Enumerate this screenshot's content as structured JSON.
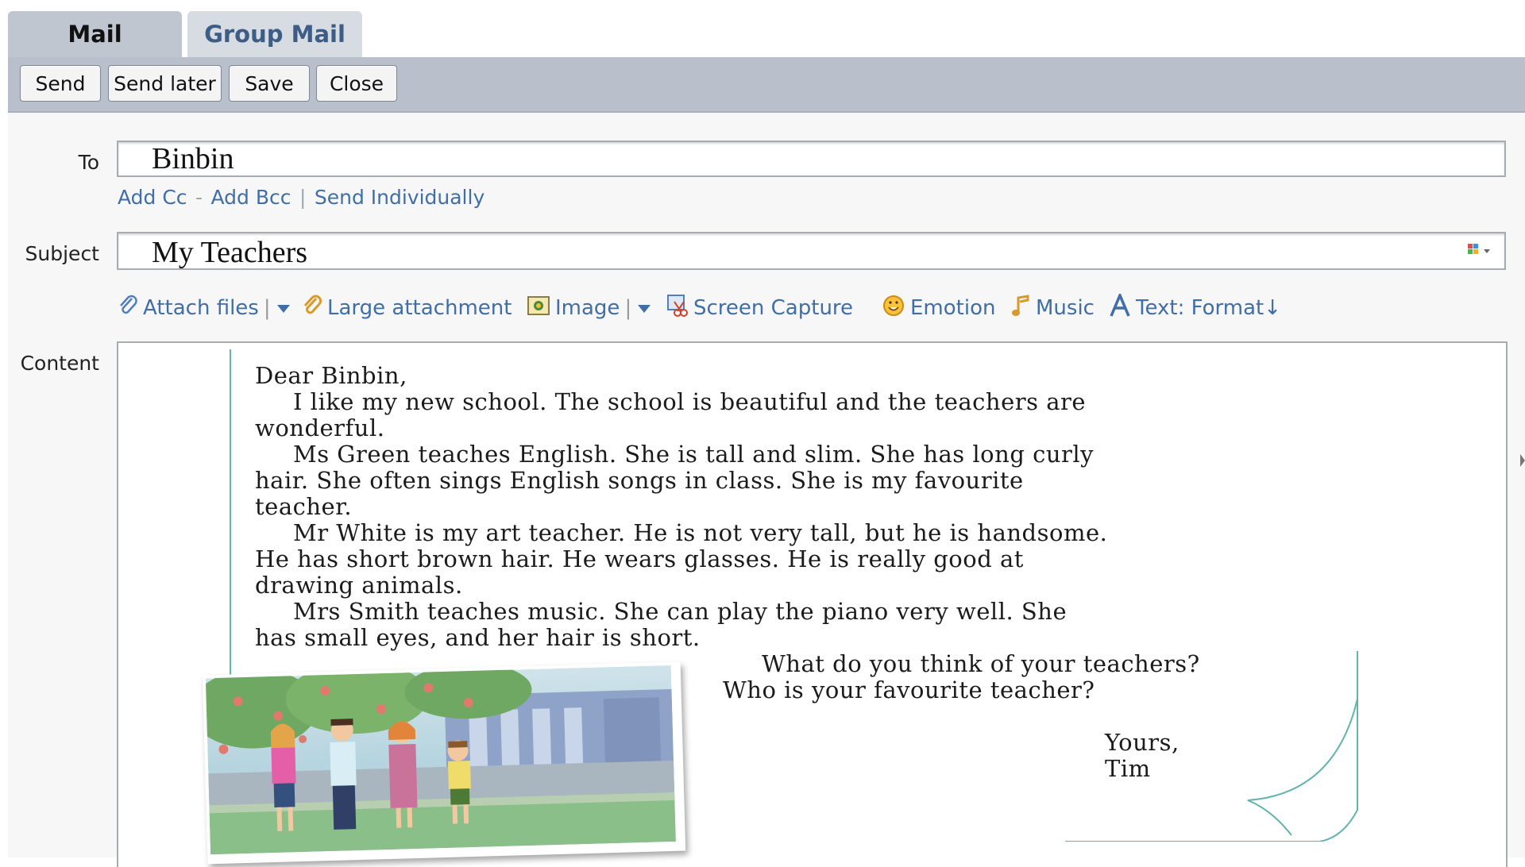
{
  "tabs": [
    {
      "label": "Mail",
      "active": true
    },
    {
      "label": "Group Mail",
      "active": false
    }
  ],
  "toolbar": {
    "send_label": "Send",
    "send_later_label": "Send later",
    "save_label": "Save",
    "close_label": "Close"
  },
  "compose": {
    "to_label": "To",
    "to_value": "Binbin",
    "add_cc": "Add Cc",
    "add_cc_sep": "-",
    "add_bcc": "Add Bcc",
    "send_sep": "|",
    "send_individually": "Send Individually",
    "subject_label": "Subject",
    "subject_value": "My Teachers",
    "content_label": "Content"
  },
  "attach_bar": {
    "attach_files": "Attach files",
    "large_attachment": "Large attachment",
    "image": "Image",
    "screen_capture": "Screen Capture",
    "emotion": "Emotion",
    "music": "Music",
    "text_format": "Text: Format↓"
  },
  "letter": {
    "lines": [
      "Dear Binbin,",
      "I like my new school. The school is beautiful and the teachers are",
      "wonderful.",
      "Ms Green teaches English. She is tall and slim. She has long curly",
      "hair. She often sings English songs in class. She is my favourite",
      "teacher.",
      "Mr White is my art teacher. He is not very tall, but he is handsome.",
      "He has short brown hair. He wears glasses. He is really good at",
      "drawing animals.",
      "Mrs Smith teaches music. She can play the piano very well. She",
      "has small eyes, and her hair is short.",
      "What do you think of your teachers?",
      "Who is your favourite teacher?",
      "Yours,",
      "Tim"
    ]
  },
  "colors": {
    "toolbar_bg": "#b9c0cb",
    "link": "#3f6ea8",
    "letter_border": "#63b3b0"
  }
}
